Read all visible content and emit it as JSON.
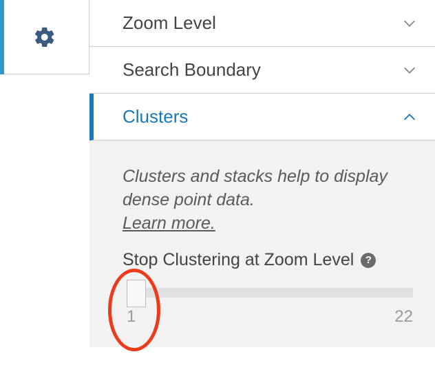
{
  "sections": {
    "zoom_level": {
      "label": "Zoom Level"
    },
    "search_boundary": {
      "label": "Search Boundary"
    },
    "clusters": {
      "label": "Clusters",
      "hint_line1": "Clusters and stacks help to display dense point data.",
      "learn_more": "Learn more.",
      "slider_label": "Stop Clustering at Zoom Level",
      "help_tooltip": "?",
      "min": "1",
      "max": "22",
      "value": "1"
    }
  }
}
